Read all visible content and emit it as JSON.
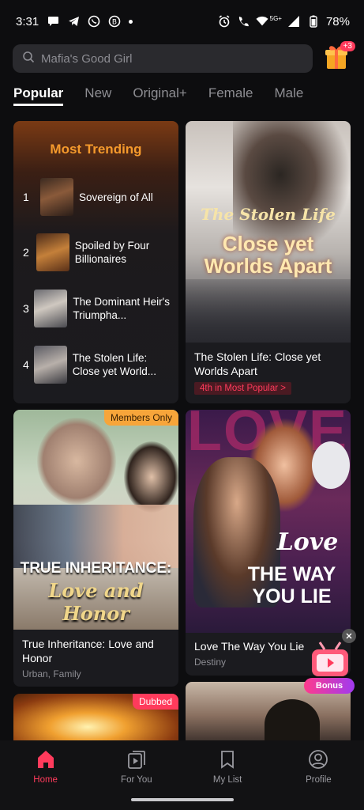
{
  "status_bar": {
    "time": "3:31",
    "battery": "78%",
    "network": "5G+"
  },
  "search": {
    "placeholder": "Mafia's Good Girl"
  },
  "gift": {
    "badge": "+3",
    "icon": "gift-icon"
  },
  "tabs": [
    {
      "label": "Popular",
      "active": true
    },
    {
      "label": "New",
      "active": false
    },
    {
      "label": "Original+",
      "active": false
    },
    {
      "label": "Female",
      "active": false
    },
    {
      "label": "Male",
      "active": false
    }
  ],
  "trending": {
    "title": "Most Trending",
    "items": [
      {
        "rank": "1",
        "name": "Sovereign of All"
      },
      {
        "rank": "2",
        "name": "Spoiled by Four Billionaires"
      },
      {
        "rank": "3",
        "name": "The Dominant Heir's Triumpha..."
      },
      {
        "rank": "4",
        "name": "The Stolen Life: Close yet World..."
      }
    ]
  },
  "cards": {
    "stolen_life": {
      "poster_line1": "The Stolen Life",
      "poster_line2": "Close yet",
      "poster_line3": "Worlds Apart",
      "title": "The Stolen Life: Close yet Worlds Apart",
      "rank_chip": "4th in Most Popular >"
    },
    "true_inheritance": {
      "badge": "Members Only",
      "poster_line1": "TRUE INHERITANCE:",
      "poster_line2": "Love and Honor",
      "title": "True Inheritance: Love and Honor",
      "genres": "Urban, Family"
    },
    "love_way": {
      "poster_bg": "LOVE",
      "poster_line1": "Love",
      "poster_line2": "THE WAY",
      "poster_line3": "YOU LIE",
      "title": "Love The Way You Lie",
      "genres": "Destiny"
    },
    "dubbed": {
      "badge": "Dubbed"
    }
  },
  "bonus": {
    "label": "Bonus"
  },
  "bottom_nav": [
    {
      "label": "Home",
      "active": true
    },
    {
      "label": "For You",
      "active": false
    },
    {
      "label": "My List",
      "active": false
    },
    {
      "label": "Profile",
      "active": false
    }
  ],
  "colors": {
    "accent": "#ff3b5c",
    "trending_title": "#f59a2c",
    "members_badge": "#f7a53a"
  }
}
